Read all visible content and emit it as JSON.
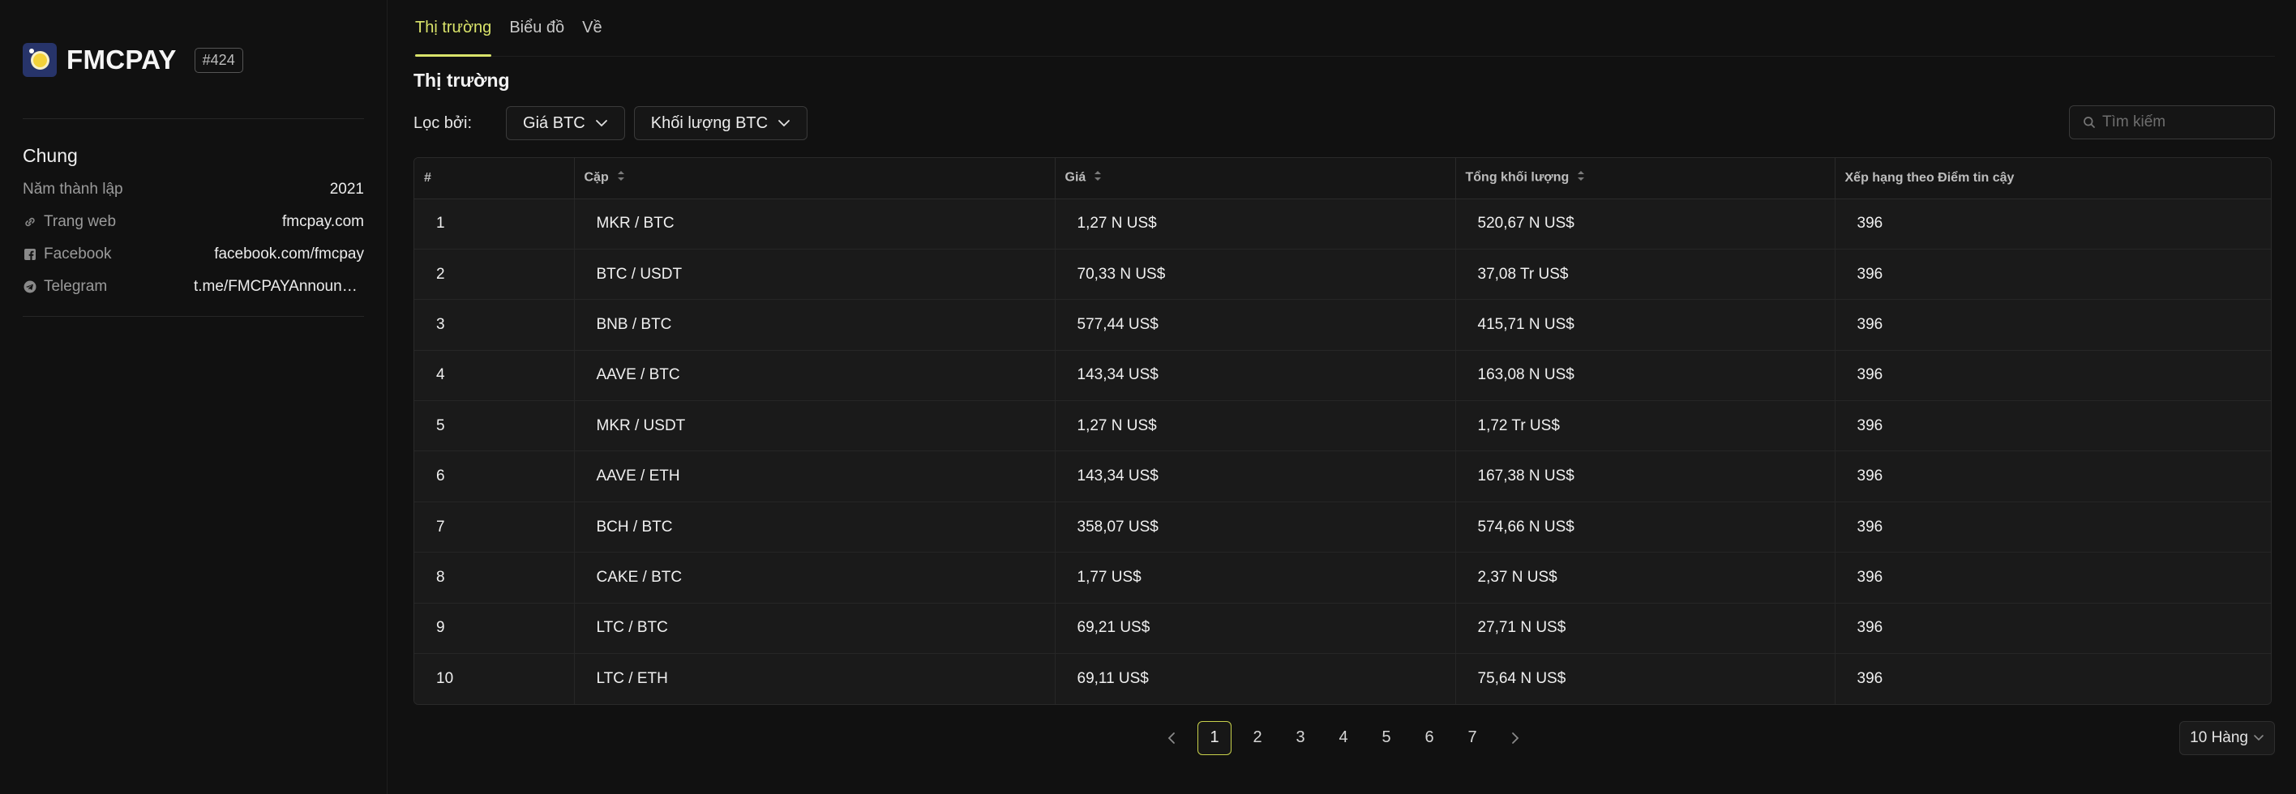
{
  "brand": {
    "name": "FMCPAY",
    "rank": "#424"
  },
  "sidebar": {
    "section_title": "Chung",
    "rows": [
      {
        "label": "Năm thành lập",
        "value": "2021",
        "icon": ""
      },
      {
        "label": "Trang web",
        "value": "fmcpay.com",
        "icon": "link-icon"
      },
      {
        "label": "Facebook",
        "value": "facebook.com/fmcpay",
        "icon": "facebook-icon"
      },
      {
        "label": "Telegram",
        "value": "t.me/FMCPAYAnnouncement",
        "icon": "telegram-icon"
      }
    ]
  },
  "tabs": [
    {
      "label": "Thị trường",
      "active": true
    },
    {
      "label": "Biểu đồ",
      "active": false
    },
    {
      "label": "Về",
      "active": false
    }
  ],
  "market": {
    "heading": "Thị trường",
    "filter_label": "Lọc bởi:",
    "filters": [
      "Giá BTC",
      "Khối lượng BTC"
    ],
    "search_placeholder": "Tìm kiếm",
    "columns": [
      "#",
      "Cặp",
      "Giá",
      "Tổng khối lượng",
      "Xếp hạng theo Điểm tin cậy"
    ],
    "rows": [
      {
        "idx": "1",
        "pair": "MKR / BTC",
        "price": "1,27 N US$",
        "volume": "520,67 N US$",
        "trust": "396"
      },
      {
        "idx": "2",
        "pair": "BTC / USDT",
        "price": "70,33 N US$",
        "volume": "37,08 Tr US$",
        "trust": "396"
      },
      {
        "idx": "3",
        "pair": "BNB / BTC",
        "price": "577,44 US$",
        "volume": "415,71 N US$",
        "trust": "396"
      },
      {
        "idx": "4",
        "pair": "AAVE / BTC",
        "price": "143,34 US$",
        "volume": "163,08 N US$",
        "trust": "396"
      },
      {
        "idx": "5",
        "pair": "MKR / USDT",
        "price": "1,27 N US$",
        "volume": "1,72 Tr US$",
        "trust": "396"
      },
      {
        "idx": "6",
        "pair": "AAVE / ETH",
        "price": "143,34 US$",
        "volume": "167,38 N US$",
        "trust": "396"
      },
      {
        "idx": "7",
        "pair": "BCH / BTC",
        "price": "358,07 US$",
        "volume": "574,66 N US$",
        "trust": "396"
      },
      {
        "idx": "8",
        "pair": "CAKE / BTC",
        "price": "1,77 US$",
        "volume": "2,37 N US$",
        "trust": "396"
      },
      {
        "idx": "9",
        "pair": "LTC / BTC",
        "price": "69,21 US$",
        "volume": "27,71 N US$",
        "trust": "396"
      },
      {
        "idx": "10",
        "pair": "LTC / ETH",
        "price": "69,11 US$",
        "volume": "75,64 N US$",
        "trust": "396"
      }
    ]
  },
  "pagination": {
    "pages": [
      "1",
      "2",
      "3",
      "4",
      "5",
      "6",
      "7"
    ],
    "current": "1",
    "rows_per_page": "10 Hàng"
  },
  "colors": {
    "accent": "#d9e36a",
    "background": "#111111"
  }
}
